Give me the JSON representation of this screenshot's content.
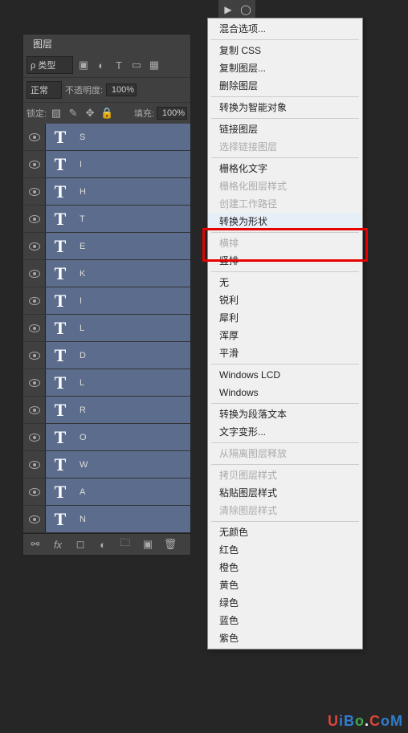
{
  "toolbar": {
    "move": "▶",
    "marquee": "◯"
  },
  "panel": {
    "tab": "图层",
    "type_filter": "ρ 类型",
    "blend_mode": "正常",
    "opacity_label": "不透明度:",
    "opacity_value": "100%",
    "lock_label": "锁定:",
    "fill_label": "填充:",
    "fill_value": "100%"
  },
  "layers": [
    {
      "name": "S"
    },
    {
      "name": "I"
    },
    {
      "name": "H"
    },
    {
      "name": "T"
    },
    {
      "name": "E"
    },
    {
      "name": "K"
    },
    {
      "name": "I"
    },
    {
      "name": "L"
    },
    {
      "name": "D"
    },
    {
      "name": "L"
    },
    {
      "name": "R"
    },
    {
      "name": "O"
    },
    {
      "name": "W"
    },
    {
      "name": "A"
    },
    {
      "name": "N"
    }
  ],
  "menu": [
    {
      "label": "混合选项...",
      "type": "item"
    },
    {
      "type": "sep"
    },
    {
      "label": "复制 CSS",
      "type": "item"
    },
    {
      "label": "复制图层...",
      "type": "item"
    },
    {
      "label": "删除图层",
      "type": "item"
    },
    {
      "type": "sep"
    },
    {
      "label": "转换为智能对象",
      "type": "item"
    },
    {
      "type": "sep"
    },
    {
      "label": "链接图层",
      "type": "item"
    },
    {
      "label": "选择链接图层",
      "type": "item",
      "disabled": true
    },
    {
      "type": "sep"
    },
    {
      "label": "栅格化文字",
      "type": "item"
    },
    {
      "label": "栅格化图层样式",
      "type": "item",
      "disabled": true
    },
    {
      "label": "创建工作路径",
      "type": "item",
      "disabled": true
    },
    {
      "label": "转换为形状",
      "type": "item",
      "highlighted": true
    },
    {
      "type": "sep"
    },
    {
      "label": "横排",
      "type": "item",
      "disabled": true
    },
    {
      "label": "竖排",
      "type": "item"
    },
    {
      "type": "sep"
    },
    {
      "label": "无",
      "type": "item"
    },
    {
      "label": "锐利",
      "type": "item"
    },
    {
      "label": "犀利",
      "type": "item"
    },
    {
      "label": "浑厚",
      "type": "item"
    },
    {
      "label": "平滑",
      "type": "item"
    },
    {
      "type": "sep"
    },
    {
      "label": "Windows LCD",
      "type": "item"
    },
    {
      "label": "Windows",
      "type": "item"
    },
    {
      "type": "sep"
    },
    {
      "label": "转换为段落文本",
      "type": "item"
    },
    {
      "label": "文字变形...",
      "type": "item"
    },
    {
      "type": "sep"
    },
    {
      "label": "从隔离图层释放",
      "type": "item",
      "disabled": true
    },
    {
      "type": "sep"
    },
    {
      "label": "拷贝图层样式",
      "type": "item",
      "disabled": true
    },
    {
      "label": "粘贴图层样式",
      "type": "item"
    },
    {
      "label": "清除图层样式",
      "type": "item",
      "disabled": true
    },
    {
      "type": "sep"
    },
    {
      "label": "无颜色",
      "type": "item"
    },
    {
      "label": "红色",
      "type": "item"
    },
    {
      "label": "橙色",
      "type": "item"
    },
    {
      "label": "黄色",
      "type": "item"
    },
    {
      "label": "绿色",
      "type": "item"
    },
    {
      "label": "蓝色",
      "type": "item"
    },
    {
      "label": "紫色",
      "type": "item"
    }
  ],
  "watermark": {
    "chars": [
      "U",
      "i",
      "B",
      "o",
      ".",
      "C",
      "o",
      "M"
    ],
    "colors": [
      "#d9463a",
      "#2f7dd0",
      "#2f7dd0",
      "#40aa50",
      "#ffffff",
      "#d9463a",
      "#2f7dd0",
      "#2f7dd0"
    ]
  }
}
